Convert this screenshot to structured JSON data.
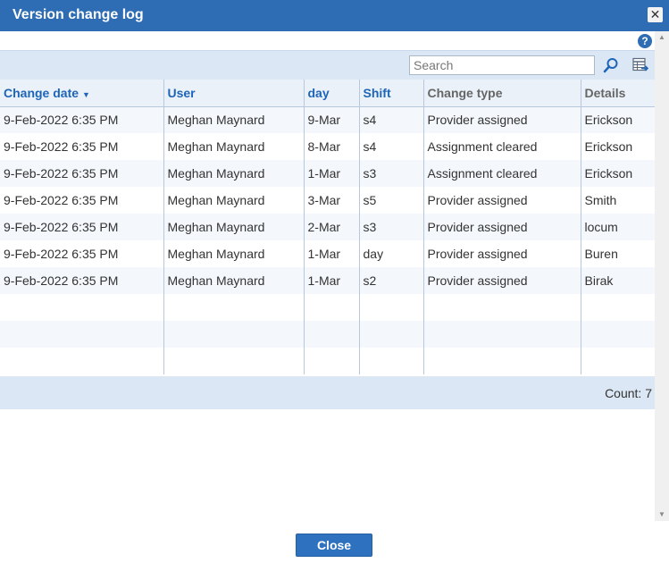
{
  "window": {
    "title": "Version change log"
  },
  "search": {
    "placeholder": "Search"
  },
  "table": {
    "columns": [
      "Change date",
      "User",
      "day",
      "Shift",
      "Change type",
      "Details"
    ],
    "rows": [
      [
        "9-Feb-2022 6:35 PM",
        "Meghan Maynard",
        "9-Mar",
        "s4",
        "Provider assigned",
        "Erickson"
      ],
      [
        "9-Feb-2022 6:35 PM",
        "Meghan Maynard",
        "8-Mar",
        "s4",
        "Assignment cleared",
        "Erickson"
      ],
      [
        "9-Feb-2022 6:35 PM",
        "Meghan Maynard",
        "1-Mar",
        "s3",
        "Assignment cleared",
        "Erickson"
      ],
      [
        "9-Feb-2022 6:35 PM",
        "Meghan Maynard",
        "3-Mar",
        "s5",
        "Provider assigned",
        "Smith"
      ],
      [
        "9-Feb-2022 6:35 PM",
        "Meghan Maynard",
        "2-Mar",
        "s3",
        "Provider assigned",
        "locum"
      ],
      [
        "9-Feb-2022 6:35 PM",
        "Meghan Maynard",
        "1-Mar",
        "day",
        "Provider assigned",
        "Buren"
      ],
      [
        "9-Feb-2022 6:35 PM",
        "Meghan Maynard",
        "1-Mar",
        "s2",
        "Provider assigned",
        "Birak"
      ]
    ],
    "count_text": "Count: 7"
  },
  "buttons": {
    "close_label": "Close"
  },
  "colors": {
    "header": "#2e6db4",
    "accent": "#1f65b7",
    "toolbar": "#dbe7f4"
  }
}
